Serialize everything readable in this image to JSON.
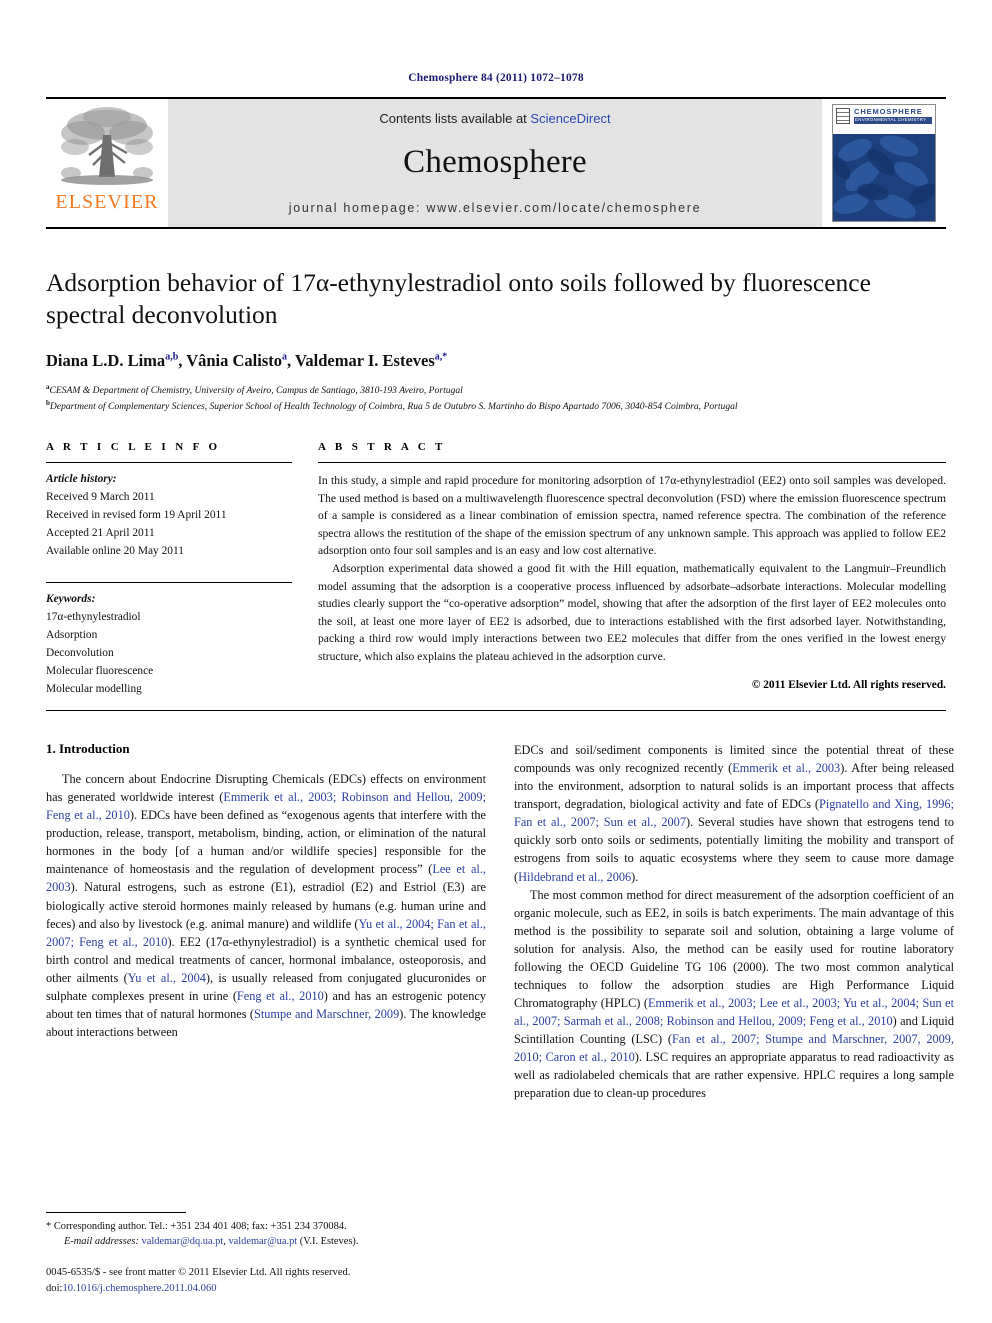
{
  "running_head": "Chemosphere 84 (2011) 1072–1078",
  "masthead": {
    "publisher_logo_name": "elsevier-tree-logo",
    "publisher_wordmark": "ELSEVIER",
    "contents_prefix": "Contents lists available at ",
    "sciencedirect": "ScienceDirect",
    "journal_title": "Chemosphere",
    "homepage": "journal homepage: www.elsevier.com/locate/chemosphere",
    "cover": {
      "name": "CHEMOSPHERE",
      "subtitle": "ENVIRONMENTAL CHEMISTRY"
    },
    "colors": {
      "elsevier_orange": "#F47920",
      "link_blue": "#2b49b5",
      "banner_gray": "#e3e3e3",
      "cover_blue": "#2b4a8a"
    }
  },
  "article": {
    "title": "Adsorption behavior of 17α-ethynylestradiol onto soils followed by fluorescence spectral deconvolution",
    "authors": "Diana L.D. Lima a,b, Vânia Calisto a, Valdemar I. Esteves a,*",
    "affiliation_a": "CESAM & Department of Chemistry, University of Aveiro, Campus de Santiago, 3810-193 Aveiro, Portugal",
    "affiliation_b": "Department of Complementary Sciences, Superior School of Health Technology of Coimbra, Rua 5 de Outubro S. Martinho do Bispo Apartado 7006, 3040-854 Coimbra, Portugal"
  },
  "article_info": {
    "heading": "A R T I C L E    I N F O",
    "history_label": "Article history:",
    "history": [
      "Received 9 March 2011",
      "Received in revised form 19 April 2011",
      "Accepted 21 April 2011",
      "Available online 20 May 2011"
    ],
    "keywords_label": "Keywords:",
    "keywords": [
      "17α-ethynylestradiol",
      "Adsorption",
      "Deconvolution",
      "Molecular fluorescence",
      "Molecular modelling"
    ]
  },
  "abstract": {
    "heading": "A B S T R A C T",
    "paragraph_1": "In this study, a simple and rapid procedure for monitoring adsorption of 17α-ethynylestradiol (EE2) onto soil samples was developed. The used method is based on a multiwavelength fluorescence spectral deconvolution (FSD) where the emission fluorescence spectrum of a sample is considered as a linear combination of emission spectra, named reference spectra. The combination of the reference spectra allows the restitution of the shape of the emission spectrum of any unknown sample. This approach was applied to follow EE2 adsorption onto four soil samples and is an easy and low cost alternative.",
    "paragraph_2": "Adsorption experimental data showed a good fit with the Hill equation, mathematically equivalent to the Langmuir–Freundlich model assuming that the adsorption is a cooperative process influenced by adsorbate–adsorbate interactions. Molecular modelling studies clearly support the “co-operative adsorption” model, showing that after the adsorption of the first layer of EE2 molecules onto the soil, at least one more layer of EE2 is adsorbed, due to interactions established with the first adsorbed layer. Notwithstanding, packing a third row would imply interactions between two EE2 molecules that differ from the ones verified in the lowest energy structure, which also explains the plateau achieved in the adsorption curve.",
    "copyright": "© 2011 Elsevier Ltd. All rights reserved."
  },
  "introduction": {
    "heading": "1. Introduction",
    "left_paragraph_1_a": "The concern about Endocrine Disrupting Chemicals (EDCs) effects on environment has generated worldwide interest (",
    "left_cite_1": "Emmerik et al., 2003; Robinson and Hellou, 2009; Feng et al., 2010",
    "left_paragraph_1_b": "). EDCs have been defined as “exogenous agents that interfere with the production, release, transport, metabolism, binding, action, or elimination of the natural hormones in the body [of a human and/or wildlife species] responsible for the maintenance of homeostasis and the regulation of development process” (",
    "left_cite_2": "Lee et al., 2003",
    "left_paragraph_1_c": "). Natural estrogens, such as estrone (E1), estradiol (E2) and Estriol (E3) are biologically active steroid hormones mainly released by humans (e.g. human urine and feces) and also by livestock (e.g. animal manure) and wildlife (",
    "left_cite_3": "Yu et al., 2004; Fan et al., 2007; Feng et al., 2010",
    "left_paragraph_1_d": "). EE2 (17α-ethynylestradiol) is a synthetic chemical used for birth control and medical treatments of cancer, hormonal imbalance, osteoporosis, and other ailments (",
    "left_cite_4": "Yu et al., 2004",
    "left_paragraph_1_e": "), is usually released from conjugated glucuronides or sulphate complexes present in urine (",
    "left_cite_5": "Feng et al., 2010",
    "left_paragraph_1_f": ") and has an estrogenic potency about ten times that of natural hormones (",
    "left_cite_6": "Stumpe and Marschner, 2009",
    "left_paragraph_1_g": "). The knowledge about interactions between",
    "right_paragraph_1_a": "EDCs and soil/sediment components is limited since the potential threat of these compounds was only recognized recently (",
    "right_cite_1": "Emmerik et al., 2003",
    "right_paragraph_1_b": "). After being released into the environment, adsorption to natural solids is an important process that affects transport, degradation, biological activity and fate of EDCs (",
    "right_cite_2": "Pignatello and Xing, 1996; Fan et al., 2007; Sun et al., 2007",
    "right_paragraph_1_c": "). Several studies have shown that estrogens tend to quickly sorb onto soils or sediments, potentially limiting the mobility and transport of estrogens from soils to aquatic ecosystems where they seem to cause more damage (",
    "right_cite_3": "Hildebrand et al., 2006",
    "right_paragraph_1_d": ").",
    "right_paragraph_2_a": "The most common method for direct measurement of the adsorption coefficient of an organic molecule, such as EE2, in soils is batch experiments. The main advantage of this method is the possibility to separate soil and solution, obtaining a large volume of solution for analysis. Also, the method can be easily used for routine laboratory following the OECD Guideline TG 106 (2000). The two most common analytical techniques to follow the adsorption studies are High Performance Liquid Chromatography (HPLC) (",
    "right_cite_4": "Emmerik et al., 2003; Lee et al., 2003; Yu et al., 2004; Sun et al., 2007; Sarmah et al., 2008; Robinson and Hellou, 2009; Feng et al., 2010",
    "right_paragraph_2_b": ") and Liquid Scintillation Counting (LSC) (",
    "right_cite_5": "Fan et al., 2007; Stumpe and Marschner, 2007, 2009, 2010; Caron et al., 2010",
    "right_paragraph_2_c": "). LSC requires an appropriate apparatus to read radioactivity as well as radiolabeled chemicals that are rather expensive. HPLC requires a long sample preparation due to clean-up procedures"
  },
  "footnotes": {
    "corresponding_marker": "*",
    "corresponding": "Corresponding author. Tel.: +351 234 401 408; fax: +351 234 370084.",
    "email_label": "E-mail addresses:",
    "email_1": "valdemar@dq.ua.pt",
    "email_sep": ", ",
    "email_2": "valdemar@ua.pt",
    "email_suffix": " (V.I. Esteves).",
    "issn_line": "0045-6535/$ - see front matter © 2011 Elsevier Ltd. All rights reserved.",
    "doi_label": "doi:",
    "doi_value": "10.1016/j.chemosphere.2011.04.060"
  }
}
